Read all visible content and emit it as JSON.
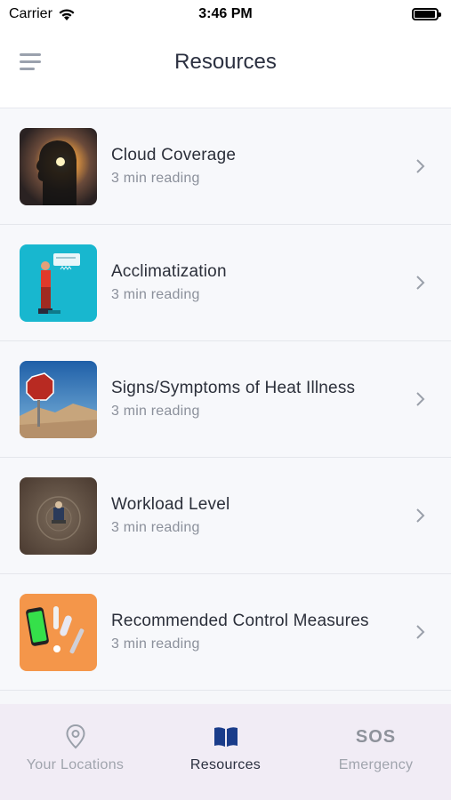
{
  "status_bar": {
    "carrier": "Carrier",
    "time": "3:46 PM",
    "battery_level": 0.95
  },
  "header": {
    "title": "Resources",
    "menu_icon": "hamburger-menu-icon"
  },
  "resources": [
    {
      "title": "Cloud Coverage",
      "subtitle": "3 min reading",
      "thumbnail": "silhouette-sun-image"
    },
    {
      "title": "Acclimatization",
      "subtitle": "3 min reading",
      "thumbnail": "worker-illustration-image"
    },
    {
      "title": "Signs/Symptoms of Heat Illness",
      "subtitle": "3 min reading",
      "thumbnail": "desert-stop-sign-image"
    },
    {
      "title": "Workload Level",
      "subtitle": "3 min reading",
      "thumbnail": "worker-on-ground-image"
    },
    {
      "title": "Recommended Control Measures",
      "subtitle": "3 min reading",
      "thumbnail": "phone-and-pills-image"
    }
  ],
  "tabbar": {
    "tabs": [
      {
        "label": "Your Locations",
        "icon": "location-pin-icon",
        "active": false
      },
      {
        "label": "Resources",
        "icon": "open-book-icon",
        "active": true
      },
      {
        "label": "Emergency",
        "icon_text": "SOS",
        "active": false
      }
    ]
  },
  "colors": {
    "tabbar_background": "#f1ecf5",
    "active_tab": "#2b3040",
    "inactive_tab": "#a0a4ad",
    "list_background": "#f7f8fb"
  }
}
